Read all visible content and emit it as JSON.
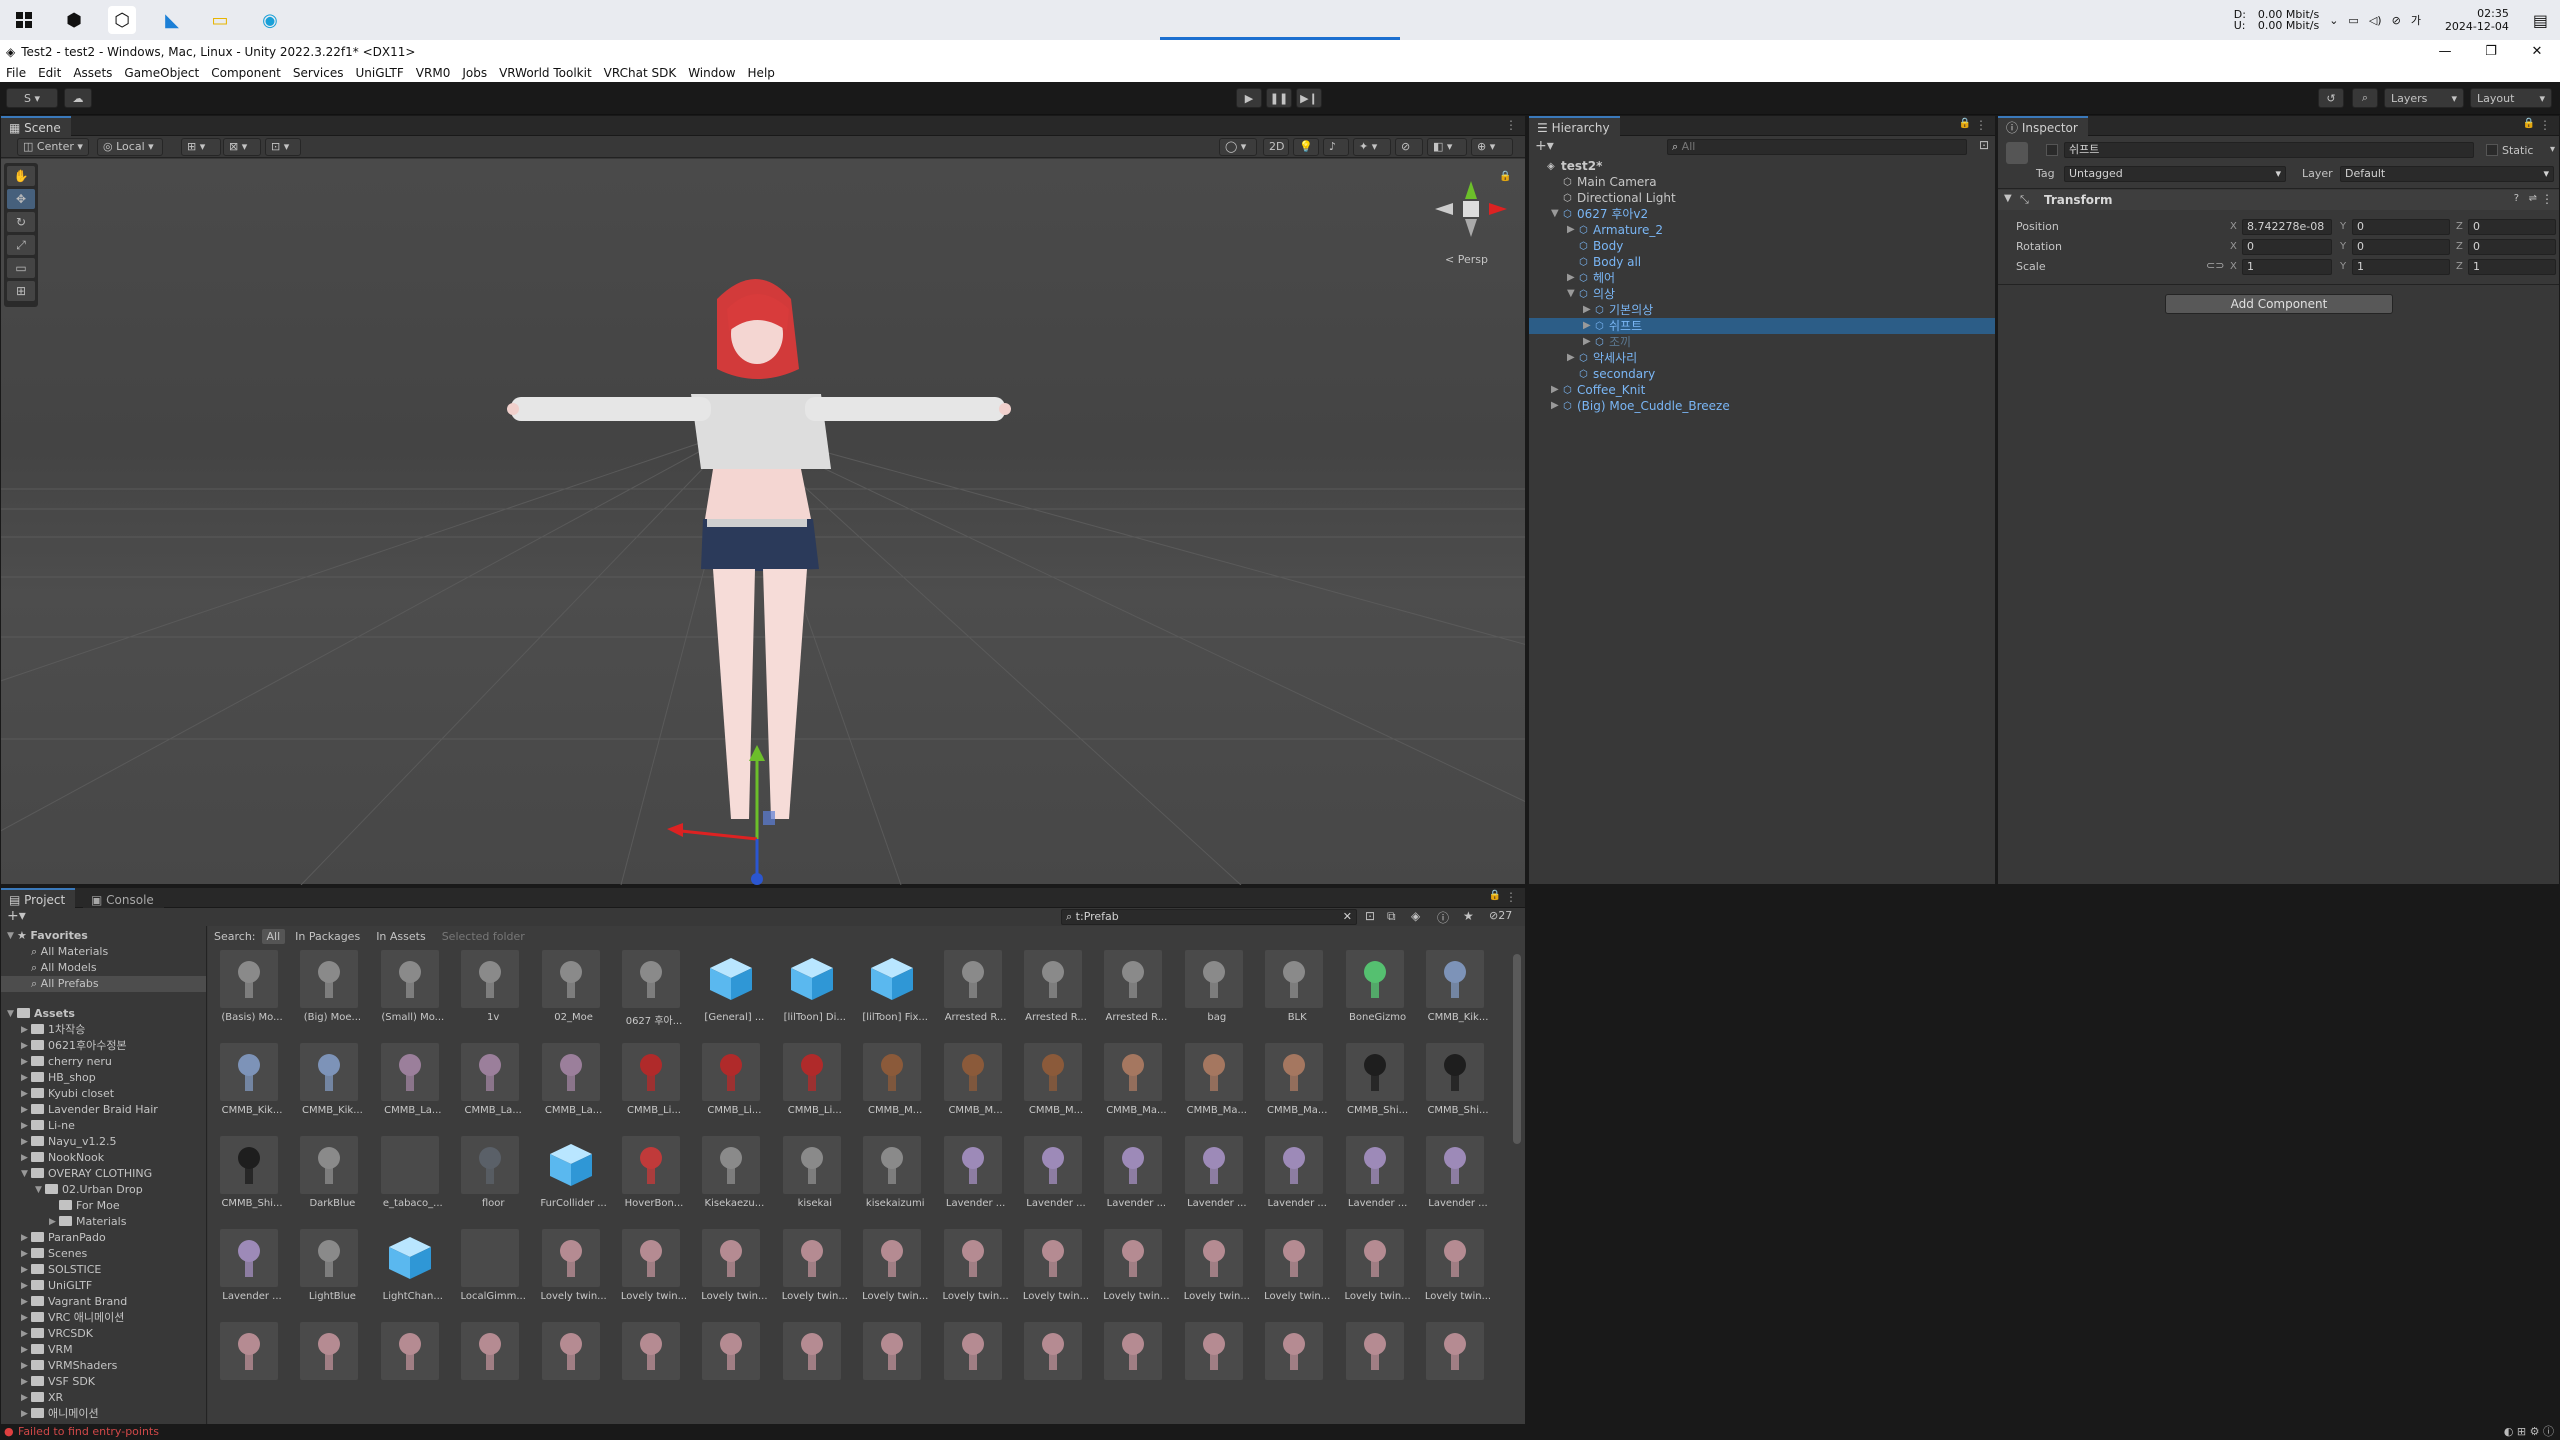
{
  "taskbar": {
    "net_down": "0.00 Mbit/s",
    "net_up": "0.00 Mbit/s",
    "net_d_label": "D:",
    "net_u_label": "U:",
    "time": "02:35",
    "date": "2024-12-04"
  },
  "window": {
    "title": "Test2 - test2 - Windows, Mac, Linux - Unity 2022.3.22f1* <DX11>"
  },
  "menu": [
    "File",
    "Edit",
    "Assets",
    "GameObject",
    "Component",
    "Services",
    "UniGLTF",
    "VRM0",
    "Jobs",
    "VRWorld Toolkit",
    "VRChat SDK",
    "Window",
    "Help"
  ],
  "toolbar": {
    "account": "S",
    "layers": "Layers",
    "layout": "Layout"
  },
  "scene": {
    "tab": "Scene",
    "pivot": "Center",
    "space": "Local",
    "mode2d": "2D",
    "persp": "< Persp"
  },
  "hierarchy": {
    "tab": "Hierarchy",
    "search_placeholder": "All",
    "rows": [
      {
        "name": "test2*",
        "depth": 0,
        "type": "scene"
      },
      {
        "name": "Main Camera",
        "depth": 1,
        "type": "obj"
      },
      {
        "name": "Directional Light",
        "depth": 1,
        "type": "obj"
      },
      {
        "name": "0627 후아v2",
        "depth": 1,
        "type": "prefab",
        "fold": "▼"
      },
      {
        "name": "Armature_2",
        "depth": 2,
        "type": "prefab",
        "fold": "▶"
      },
      {
        "name": "Body",
        "depth": 2,
        "type": "prefab"
      },
      {
        "name": "Body all",
        "depth": 2,
        "type": "prefab"
      },
      {
        "name": "헤어",
        "depth": 2,
        "type": "prefab",
        "fold": "▶"
      },
      {
        "name": "의상",
        "depth": 2,
        "type": "prefab",
        "fold": "▼"
      },
      {
        "name": "기본의상",
        "depth": 3,
        "type": "prefab",
        "fold": "▶"
      },
      {
        "name": "쉬프트",
        "depth": 3,
        "type": "prefab",
        "fold": "▶",
        "selected": true
      },
      {
        "name": "조끼",
        "depth": 3,
        "type": "prefabdim",
        "fold": "▶"
      },
      {
        "name": "악세사리",
        "depth": 2,
        "type": "prefab",
        "fold": "▶"
      },
      {
        "name": "secondary",
        "depth": 2,
        "type": "prefab"
      },
      {
        "name": "Coffee_Knit",
        "depth": 1,
        "type": "prefab",
        "fold": "▶"
      },
      {
        "name": "(Big) Moe_Cuddle_Breeze",
        "depth": 1,
        "type": "prefab",
        "fold": "▶"
      }
    ]
  },
  "inspector": {
    "tab": "Inspector",
    "object_name": "쉬프트",
    "static": "Static",
    "tag_label": "Tag",
    "tag": "Untagged",
    "layer_label": "Layer",
    "layer": "Default",
    "component": "Transform",
    "position_label": "Position",
    "rotation_label": "Rotation",
    "scale_label": "Scale",
    "pos": {
      "x": "8.742278e-08",
      "y": "0",
      "z": "0"
    },
    "rot": {
      "x": "0",
      "y": "0",
      "z": "0"
    },
    "scl": {
      "x": "1",
      "y": "1",
      "z": "1"
    },
    "add_component": "Add Component"
  },
  "project": {
    "tab": "Project",
    "console_tab": "Console",
    "search_value": "t:Prefab",
    "result_count": "27",
    "search_label": "Search:",
    "scope_all": "All",
    "scope_packages": "In Packages",
    "scope_assets": "In Assets",
    "scope_selected": "Selected folder",
    "favorites": {
      "label": "Favorites",
      "items": [
        "All Materials",
        "All Models",
        "All Prefabs"
      ]
    },
    "assets_label": "Assets",
    "folders": [
      "1차작승",
      "0621후아수정본",
      "cherry neru",
      "HB_shop",
      "Kyubi closet",
      "Lavender Braid Hair",
      "Li-ne",
      "Nayu_v1.2.5",
      "NookNook",
      "OVERAY CLOTHING",
      "02.Urban Drop",
      "For Moe",
      "Materials",
      "ParanPado",
      "Scenes",
      "SOLSTICE",
      "UniGLTF",
      "Vagrant Brand",
      "VRC 애니메이션",
      "VRCSDK",
      "VRM",
      "VRMShaders",
      "VSF SDK",
      "XR",
      "애니메이션"
    ],
    "assets": [
      "(Basis) Mo...",
      "(Big) Moe...",
      "(Small) Mo...",
      "1v",
      "02_Moe",
      "0627 후아...",
      "[General] ...",
      "[lilToon] Di...",
      "[lilToon] Fix...",
      "Arrested R...",
      "Arrested R...",
      "Arrested R...",
      "bag",
      "BLK",
      "BoneGizmo",
      "CMMB_Kik...",
      "CMMB_Kik...",
      "CMMB_Kik...",
      "CMMB_La...",
      "CMMB_La...",
      "CMMB_La...",
      "CMMB_Li...",
      "CMMB_Li...",
      "CMMB_Li...",
      "CMMB_M...",
      "CMMB_M...",
      "CMMB_M...",
      "CMMB_Ma...",
      "CMMB_Ma...",
      "CMMB_Ma...",
      "CMMB_Shi...",
      "CMMB_Shi...",
      "CMMB_Shi...",
      "DarkBlue",
      "e_tabaco_...",
      "floor",
      "FurCollider ...",
      "HoverBon...",
      "Kisekaezu...",
      "kisekai",
      "kisekaizumi",
      "Lavender ...",
      "Lavender ...",
      "Lavender ...",
      "Lavender ...",
      "Lavender ...",
      "Lavender ...",
      "Lavender ...",
      "Lavender ...",
      "LightBlue",
      "LightChan...",
      "LocalGimm...",
      "Lovely twin...",
      "Lovely twin...",
      "Lovely twin...",
      "Lovely twin...",
      "Lovely twin...",
      "Lovely twin...",
      "Lovely twin...",
      "Lovely twin...",
      "Lovely twin...",
      "Lovely twin...",
      "Lovely twin...",
      "Lovely twin...",
      "",
      "",
      "",
      "",
      "",
      "",
      "",
      "",
      "",
      "",
      "",
      "",
      "",
      "",
      "",
      ""
    ]
  },
  "status": {
    "message": "Failed to find entry-points"
  }
}
